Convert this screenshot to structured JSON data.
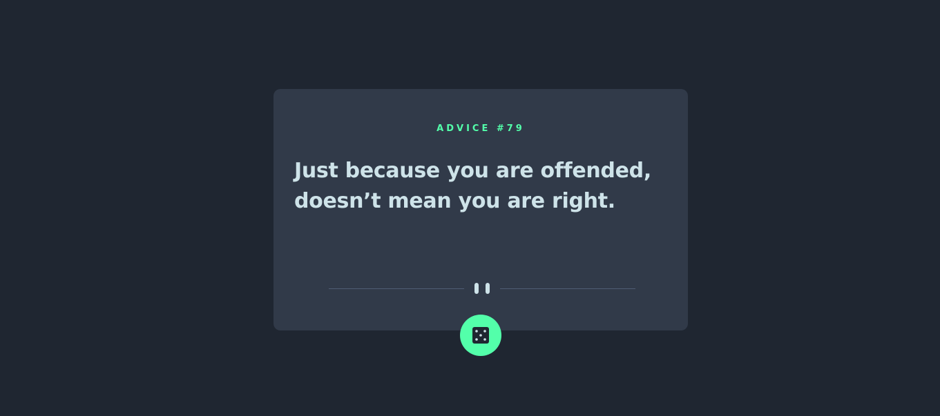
{
  "advice": {
    "title": "ADVICE #79",
    "quote": "Just because you are offended, doesn’t mean you are right."
  },
  "icons": {
    "divider": "pause-icon",
    "button": "dice-icon"
  },
  "colors": {
    "background": "#1f2631",
    "card": "#313a49",
    "accent": "#53ffaa",
    "text": "#cee3e9",
    "divider": "#4f5d74"
  }
}
